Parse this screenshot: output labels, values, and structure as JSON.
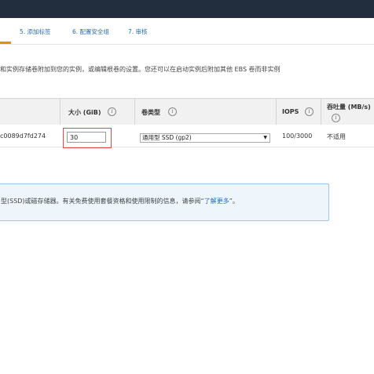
{
  "wizard": {
    "steps": [
      {
        "label": "5. 添加标签"
      },
      {
        "label": "6. 配置安全组"
      },
      {
        "label": "7. 审核"
      }
    ]
  },
  "description": "和实例存储卷附加到您的实例，或编辑根卷的设置。您还可以在启动实例后附加其他 EBS 卷而非实例",
  "storage_table": {
    "headers": {
      "size": "大小 (GiB)",
      "volume_type": "卷类型",
      "iops": "IOPS",
      "throughput": "吞吐量 (MB/s)"
    },
    "rows": [
      {
        "snapshot": "c0089d7fd274",
        "size": "30",
        "volume_type": "通用型 SSD (gp2)",
        "iops": "100/3000",
        "throughput": "不适用"
      }
    ]
  },
  "notice": {
    "text": "型(SSD)或磁存储器。有关免费使用套餐资格和使用限制的信息，请参阅“",
    "link": "了解更多",
    "suffix": "”。"
  },
  "colors": {
    "topbar": "#222e3e",
    "link": "#2a6db0",
    "highlight_border": "#e04a4a",
    "notice_bg": "#eef5fb"
  }
}
